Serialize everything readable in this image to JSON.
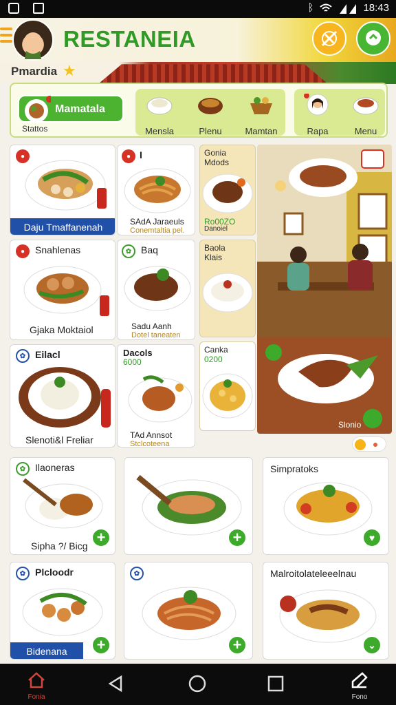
{
  "status": {
    "time": "18:43"
  },
  "header": {
    "title": "RESTANEIA",
    "username": "Pmardia"
  },
  "categories": {
    "active": "Mamatala",
    "status_label": "Stattos",
    "items": [
      "Mensla",
      "Plenu",
      "Mamtan",
      "Rapa",
      "Menu"
    ]
  },
  "cards": [
    {
      "title": "Daju Tmaffanenah",
      "badge": "●"
    },
    {
      "title": "I",
      "sub": "SAdA Jaraeuls",
      "sub2": "Conemtaltia pel.",
      "badge": "●"
    },
    {
      "title": "Snahlenas",
      "sub": "Gjaka Moktaiol",
      "badge": "●"
    },
    {
      "title": "Baq",
      "sub": "Sadu Aanh",
      "sub2": "Dotel taneaten",
      "badge": "✿"
    },
    {
      "title": "Eilacl",
      "sub": "Slenoti&l Freliar",
      "badge": "✿"
    },
    {
      "title": "Dacols",
      "price": "6000",
      "sub": "TAd Annsot",
      "sub2": "Stclcoteena",
      "badge": ""
    }
  ],
  "narrow": [
    {
      "title": "Gonia",
      "sub": "Mdods",
      "price": "Ro00ZO",
      "price2": "Danoiel"
    },
    {
      "title": "Baola",
      "sub": "Klais"
    },
    {
      "title": "Canka",
      "price": "0200"
    }
  ],
  "photo": {
    "label": "Slonio"
  },
  "grid": [
    {
      "title": "Ilaoneras",
      "sub": "Sipha ?/ Bicg",
      "badge": "✿"
    },
    {
      "title": "",
      "sub": "",
      "badge": ""
    },
    {
      "title": "Simpratoks",
      "sub": "",
      "badge": ""
    },
    {
      "title": "Plcloodr",
      "bar": "Bidenana",
      "badge": "✿"
    },
    {
      "title": "",
      "sub": "",
      "badge": "✿"
    },
    {
      "title": "Malroitolateleeelnau",
      "sub": "",
      "badge": ""
    }
  ],
  "nav": {
    "home": "Fonia",
    "grid": "Fono"
  },
  "colors": {
    "brand": "#2f9a25",
    "accent": "#f7b51f",
    "blue": "#2150a8",
    "red": "#d73125"
  }
}
